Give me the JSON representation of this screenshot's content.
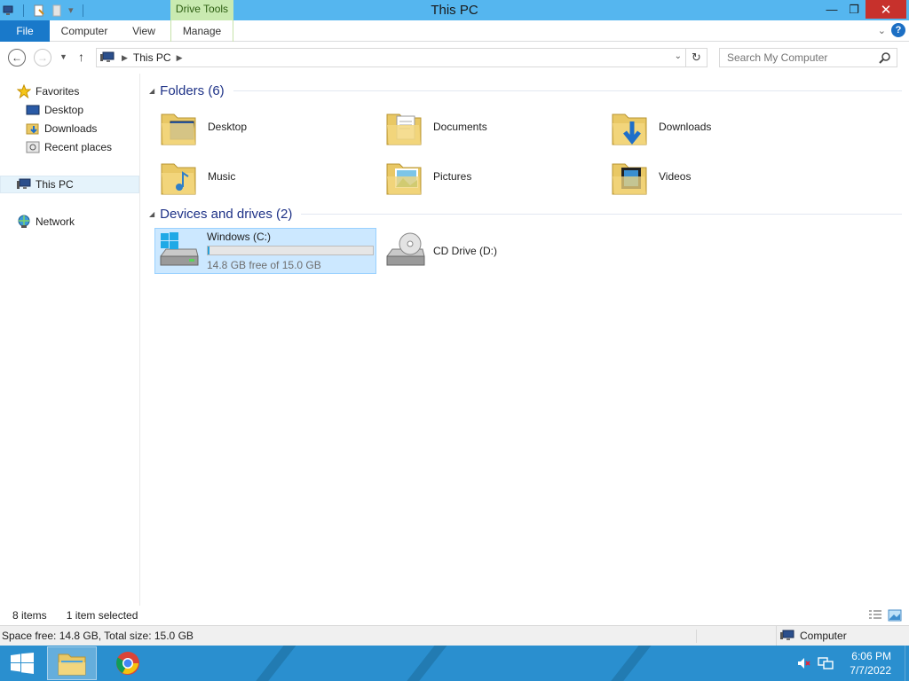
{
  "window": {
    "title": "This PC",
    "context_tab_group": "Drive Tools",
    "close_glyph": "✕",
    "maximize_glyph": "❐",
    "minimize_glyph": "—"
  },
  "ribbon": {
    "tabs": [
      {
        "label": "File"
      },
      {
        "label": "Computer"
      },
      {
        "label": "View"
      },
      {
        "label": "Manage"
      }
    ],
    "help_glyph": "?"
  },
  "address": {
    "breadcrumb": "This PC",
    "search_placeholder": "Search My Computer"
  },
  "nav_pane": {
    "favorites_label": "Favorites",
    "favorites": [
      {
        "label": "Desktop"
      },
      {
        "label": "Downloads"
      },
      {
        "label": "Recent places"
      }
    ],
    "this_pc_label": "This PC",
    "network_label": "Network"
  },
  "content": {
    "folders_header": "Folders (6)",
    "folders": [
      {
        "label": "Desktop"
      },
      {
        "label": "Documents"
      },
      {
        "label": "Downloads"
      },
      {
        "label": "Music"
      },
      {
        "label": "Pictures"
      },
      {
        "label": "Videos"
      }
    ],
    "devices_header": "Devices and drives (2)",
    "drives": [
      {
        "label": "Windows (C:)",
        "free_text": "14.8 GB free of 15.0 GB",
        "used_fraction": 0.013
      },
      {
        "label": "CD Drive (D:)"
      }
    ]
  },
  "status": {
    "item_count": "8 items",
    "selection": "1 item selected",
    "space_info": "Space free: 14.8 GB, Total size: 15.0 GB",
    "location": "Computer"
  },
  "taskbar": {
    "time": "6:06 PM",
    "date": "7/7/2022"
  },
  "colors": {
    "titlebar": "#55b6ef",
    "file_tab": "#1979ca",
    "context_tab": "#c9eab1",
    "close_button": "#c7312c",
    "selection": "#cce8ff",
    "taskbar": "#2a8fcf",
    "drive_bar": "#26a0da"
  }
}
